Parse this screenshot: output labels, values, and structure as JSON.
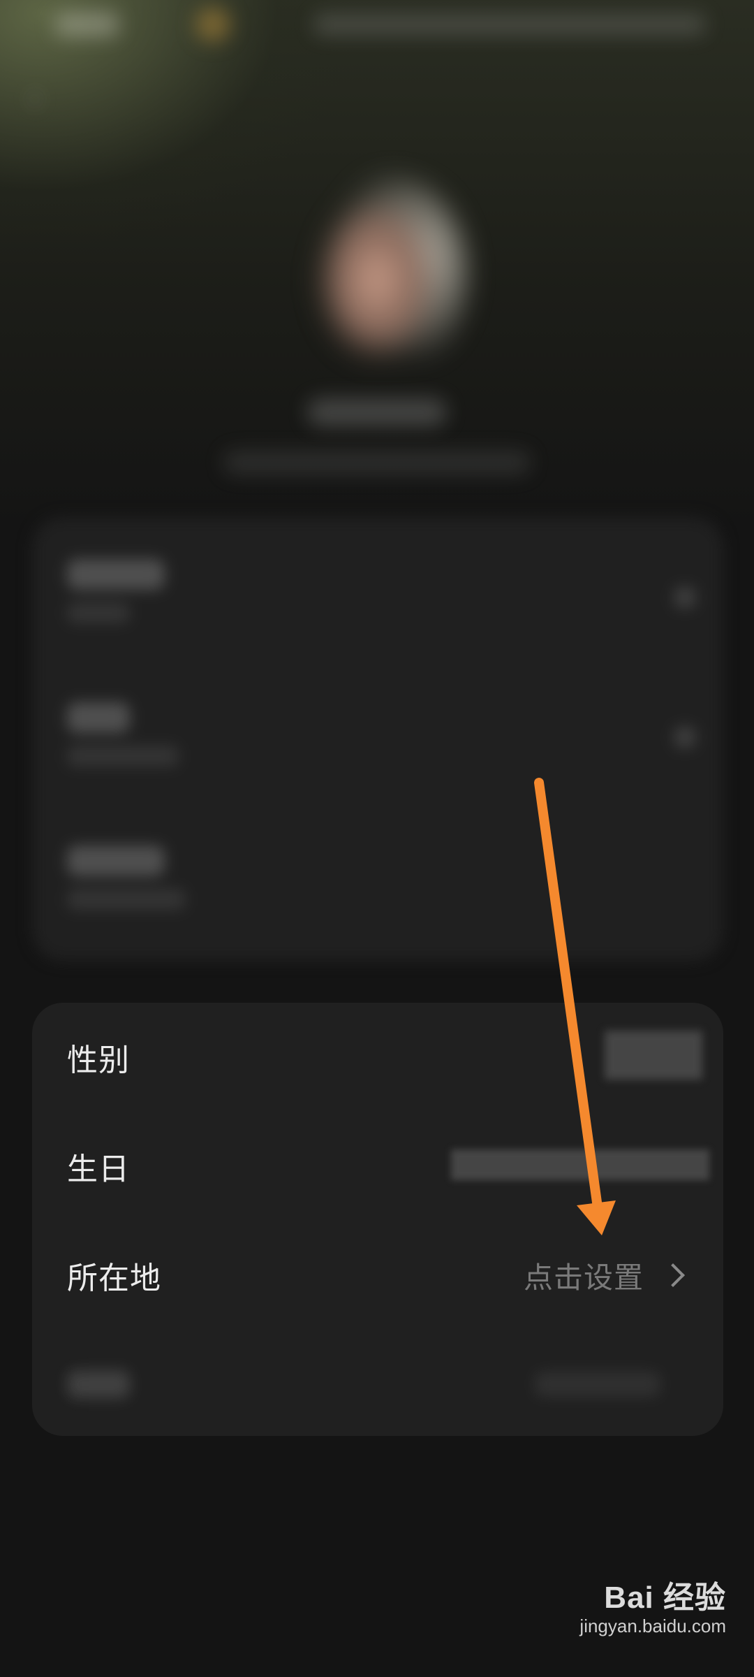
{
  "profile": {
    "name": "",
    "subtitle": ""
  },
  "info_card": {
    "rows": [
      {
        "label": "性别",
        "value": ""
      },
      {
        "label": "生日",
        "value": ""
      },
      {
        "label": "所在地",
        "value": "点击设置"
      }
    ]
  },
  "annotation": {
    "arrow_color": "#f5892e"
  },
  "watermark": {
    "logo": "Bai 经验",
    "url": "jingyan.baidu.com"
  },
  "colors": {
    "background": "#141414",
    "card": "#202020",
    "label": "#ececec",
    "value": "#7a7a7a"
  }
}
